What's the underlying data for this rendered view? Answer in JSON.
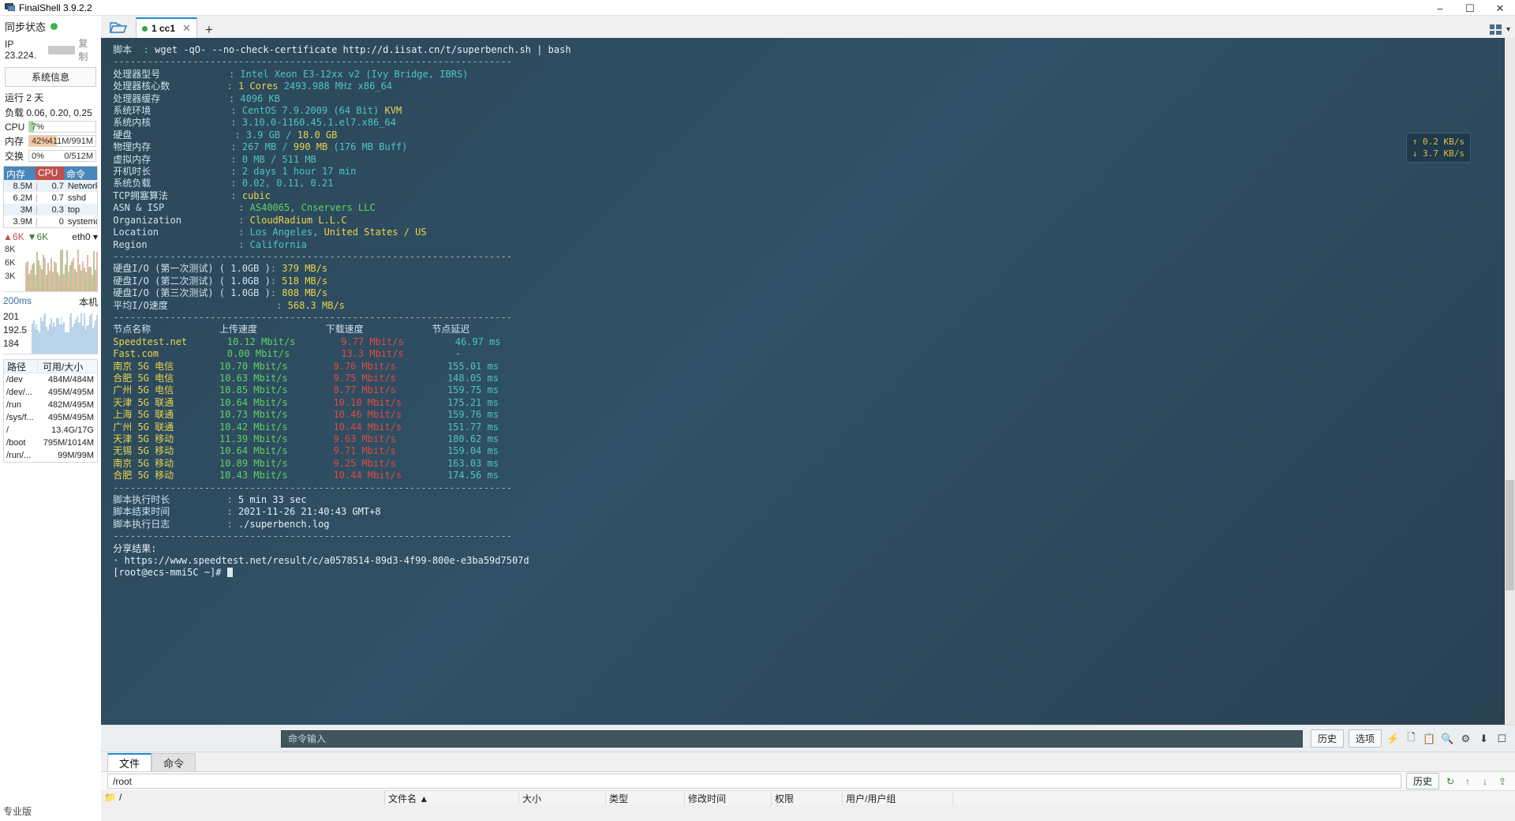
{
  "window": {
    "title": "FinalShell 3.9.2.2",
    "app_icon": "monitor-icon",
    "minimize": "–",
    "maximize": "☐",
    "close": "✕"
  },
  "sidebar": {
    "sync_label": "同步状态",
    "ip_label": "IP 23.224.",
    "copy_label": "复制",
    "sysinfo_button": "系统信息",
    "uptime": "运行 2 天",
    "load": "负载 0.06, 0.20, 0.25",
    "meters": [
      {
        "label": "CPU",
        "percent": "7%",
        "right": "",
        "fill_pct": 7,
        "fill_color": "#9fdca0"
      },
      {
        "label": "内存",
        "percent": "42%",
        "right": "411M/991M",
        "fill_pct": 42,
        "fill_color": "#f5c9a0"
      },
      {
        "label": "交换",
        "percent": "0%",
        "right": "0/512M",
        "fill_pct": 0,
        "fill_color": "#f5c9a0"
      }
    ],
    "proc_headers": {
      "mem": "内存",
      "cpu": "CPU",
      "cmd": "命令"
    },
    "processes": [
      {
        "mem": "8.5M",
        "cpu": "0.7",
        "cmd": "Network"
      },
      {
        "mem": "6.2M",
        "cpu": "0.7",
        "cmd": "sshd"
      },
      {
        "mem": "3M",
        "cpu": "0.3",
        "cmd": "top"
      },
      {
        "mem": "3.9M",
        "cpu": "0",
        "cmd": "systemd"
      }
    ],
    "net": {
      "up": "6K",
      "down": "6K",
      "interface": "eth0",
      "axis": [
        "8K",
        "6K",
        "3K"
      ]
    },
    "latency": {
      "ms_label": "200ms",
      "host_label": "本机",
      "axis": [
        "201",
        "192.5",
        "184"
      ]
    },
    "disk_headers": {
      "path": "路径",
      "size": "可用/大小"
    },
    "disks": [
      {
        "path": "/dev",
        "size": "484M/484M"
      },
      {
        "path": "/dev/...",
        "size": "495M/495M"
      },
      {
        "path": "/run",
        "size": "482M/495M"
      },
      {
        "path": "/sys/f...",
        "size": "495M/495M"
      },
      {
        "path": "/",
        "size": "13.4G/17G"
      },
      {
        "path": "/boot",
        "size": "795M/1014M"
      },
      {
        "path": "/run/...",
        "size": "99M/99M"
      }
    ],
    "pro_badge": "专业版"
  },
  "tabbar": {
    "folder_icon": "folder-open-icon",
    "tab_label": "1 cc1",
    "tab_close": "✕",
    "new_tab": "+",
    "layout_icon": "grid-layout-icon",
    "chevron": "▾"
  },
  "net_toast": {
    "up": "↑ 0.2 KB/s",
    "down": "↓ 3.7 KB/s"
  },
  "terminal": {
    "script_label": "脚本",
    "script_cmd": "wget -qO- --no-check-certificate http://d.iisat.cn/t/superbench.sh | bash",
    "divider": "----------------------------------------------------------------------",
    "sysinfo": [
      {
        "key": "处理器型号",
        "value": "Intel Xeon E3-12xx v2 (Ivy Bridge, IBRS)",
        "color": "cyan"
      },
      {
        "key": "处理器核心数",
        "value": "1 Cores",
        "value2": "2493.988 MHz x86_64",
        "color": "yellow",
        "color2": "cyan"
      },
      {
        "key": "处理器缓存",
        "value": "4096 KB",
        "color": "cyan"
      },
      {
        "key": "系统环境",
        "value": "CentOS 7.9.2009 (64 Bit)",
        "value2": "KVM",
        "color": "cyan",
        "color2": "yellow"
      },
      {
        "key": "系统内核",
        "value": "3.10.0-1160.45.1.el7.x86_64",
        "color": "cyan"
      },
      {
        "key": "硬盘",
        "value": "3.9 GB /",
        "value2": "18.0 GB",
        "color": "cyan",
        "color2": "yellow"
      },
      {
        "key": "物理内存",
        "value": "267 MB /",
        "value2": "990 MB",
        "value3": "(176 MB Buff)",
        "color": "cyan",
        "color2": "yellow",
        "color3": "cyan"
      },
      {
        "key": "虚拟内存",
        "value": "0 MB / 511 MB",
        "color": "cyan"
      },
      {
        "key": "开机时长",
        "value": "2 days 1 hour 17 min",
        "color": "cyan"
      },
      {
        "key": "系统负载",
        "value": "0.02, 0.11, 0.21",
        "color": "cyan"
      },
      {
        "key": "TCP拥塞算法",
        "value": "cubic",
        "color": "yellow"
      },
      {
        "key": "ASN & ISP",
        "value": "AS40065, Cnservers LLC",
        "color": "green"
      },
      {
        "key": "Organization",
        "value": "CloudRadium L.L.C",
        "color": "yellow"
      },
      {
        "key": "Location",
        "value": "Los Angeles,",
        "value2": "United States / US",
        "color": "cyan",
        "color2": "yellow"
      },
      {
        "key": "Region",
        "value": "California",
        "color": "cyan"
      }
    ],
    "io_tests": [
      {
        "key": "硬盘I/O (第一次测试) ( 1.0GB )",
        "value": "379 MB/s"
      },
      {
        "key": "硬盘I/O (第二次测试) ( 1.0GB )",
        "value": "518 MB/s"
      },
      {
        "key": "硬盘I/O (第三次测试) ( 1.0GB )",
        "value": "808 MB/s"
      },
      {
        "key": "平均I/O速度",
        "value": "568.3 MB/s"
      }
    ],
    "speed_headers": {
      "node": "节点名称",
      "upload": "上传速度",
      "download": "下载速度",
      "latency": "节点延迟"
    },
    "speedtest": [
      {
        "node": "Speedtest.net",
        "node_color": "yellow",
        "upload": "10.12 Mbit/s",
        "download": "9.77 Mbit/s",
        "latency": "46.97 ms"
      },
      {
        "node": "Fast.com",
        "node_color": "yellow",
        "upload": "0.00 Mbit/s",
        "download": "13.3 Mbit/s",
        "latency": "-"
      },
      {
        "node": "南京 5G 电信",
        "node_color": "yellow",
        "upload": "10.70 Mbit/s",
        "download": "9.76 Mbit/s",
        "latency": "155.01 ms"
      },
      {
        "node": "合肥 5G 电信",
        "node_color": "yellow",
        "upload": "10.63 Mbit/s",
        "download": "9.75 Mbit/s",
        "latency": "148.05 ms"
      },
      {
        "node": "广州 5G 电信",
        "node_color": "yellow",
        "upload": "10.85 Mbit/s",
        "download": "8.77 Mbit/s",
        "latency": "159.75 ms"
      },
      {
        "node": "天津 5G 联通",
        "node_color": "yellow",
        "upload": "10.64 Mbit/s",
        "download": "10.10 Mbit/s",
        "latency": "175.21 ms"
      },
      {
        "node": "上海 5G 联通",
        "node_color": "yellow",
        "upload": "10.73 Mbit/s",
        "download": "10.46 Mbit/s",
        "latency": "159.76 ms"
      },
      {
        "node": "广州 5G 联通",
        "node_color": "yellow",
        "upload": "10.42 Mbit/s",
        "download": "10.44 Mbit/s",
        "latency": "151.77 ms"
      },
      {
        "node": "天津 5G 移动",
        "node_color": "yellow",
        "upload": "11.39 Mbit/s",
        "download": "9.63 Mbit/s",
        "latency": "180.62 ms"
      },
      {
        "node": "无锡 5G 移动",
        "node_color": "yellow",
        "upload": "10.64 Mbit/s",
        "download": "9.71 Mbit/s",
        "latency": "159.04 ms"
      },
      {
        "node": "南京 5G 移动",
        "node_color": "yellow",
        "upload": "10.89 Mbit/s",
        "download": "9.25 Mbit/s",
        "latency": "163.03 ms"
      },
      {
        "node": "合肥 5G 移动",
        "node_color": "yellow",
        "upload": "10.43 Mbit/s",
        "download": "10.44 Mbit/s",
        "latency": "174.56 ms"
      }
    ],
    "footer": [
      {
        "key": "脚本执行时长",
        "value": "5 min 33 sec"
      },
      {
        "key": "脚本结束时间",
        "value": "2021-11-26 21:40:43 GMT+8"
      },
      {
        "key": "脚本执行日志",
        "value": "./superbench.log"
      }
    ],
    "share_label": "分享结果:",
    "share_url": "· https://www.speedtest.net/result/c/a0578514-89d3-4f99-800e-e3ba59d7507d",
    "prompt": "[root@ecs-mmi5C ~]#"
  },
  "command_bar": {
    "placeholder": "命令输入",
    "history_button": "历史",
    "options_button": "选项",
    "icons": [
      "lightning-icon",
      "copy-icon",
      "paste-icon",
      "search-icon",
      "gear-icon",
      "download-icon",
      "window-icon"
    ]
  },
  "bottom_panel": {
    "tabs": [
      {
        "label": "文件",
        "active": true
      },
      {
        "label": "命令",
        "active": false
      }
    ],
    "path_value": "/root",
    "history_button": "历史",
    "icons": [
      "refresh-icon",
      "upload-icon",
      "download-icon",
      "upload-file-icon"
    ],
    "file_headers": [
      "文件名",
      "大小",
      "类型",
      "修改时间",
      "权限",
      "用户/用户组"
    ],
    "tree_root": "/",
    "sort_arrow": "▲"
  }
}
